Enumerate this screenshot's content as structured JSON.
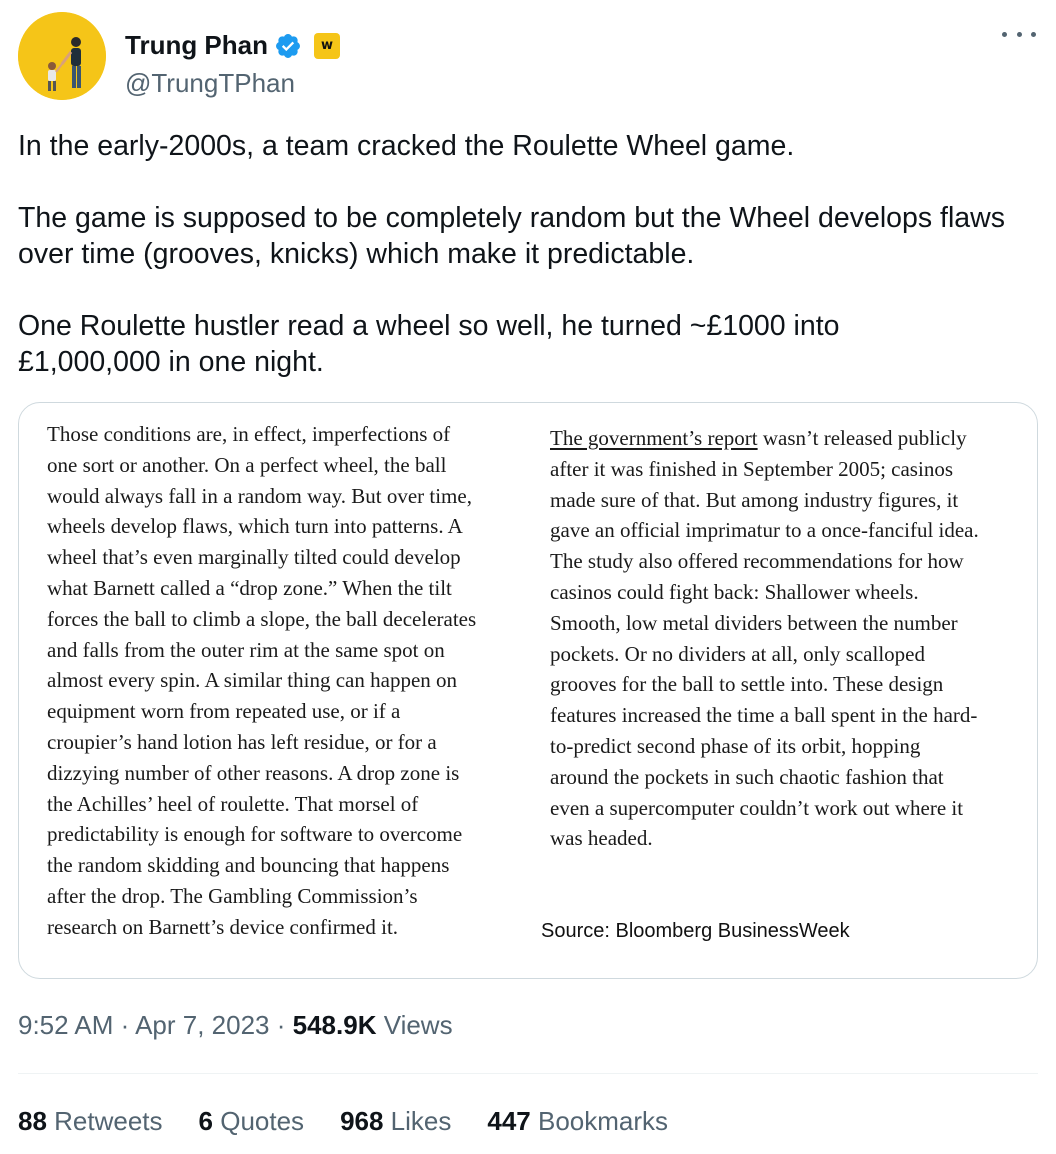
{
  "author": {
    "display_name": "Trung Phan",
    "handle": "@TrungTPhan",
    "affiliate_badge_text": "w"
  },
  "icons": {
    "verified": "verified-badge-icon",
    "affiliate": "affiliate-badge-icon",
    "more": "more-options-icon"
  },
  "colors": {
    "verified_blue": "#1d9bf0",
    "avatar_bg": "#f5c518",
    "secondary_text": "#536471"
  },
  "tweet": {
    "para1": "In the early-2000s, a team cracked the Roulette Wheel game.",
    "para2": "The game is supposed to be completely random but the Wheel develops flaws over time (grooves, knicks) which make it predictable.",
    "para3": "One Roulette hustler read a wheel so well, he turned ~£1000 into £1,000,000 in one night."
  },
  "media": {
    "left_lines": [
      "Those conditions are, in effect, imperfections of",
      "one sort or another. On a perfect wheel, the ball",
      "would always fall in a random way. But over time,",
      "wheels develop flaws, which turn into patterns. A",
      "wheel that’s even marginally tilted could develop",
      "what Barnett called a “drop zone.” When the tilt",
      "forces the ball to climb a slope, the ball decelerates",
      "and falls from the outer rim at the same spot on",
      "almost every spin. A similar thing can happen on",
      "equipment worn from repeated use, or if a",
      "croupier’s hand lotion has left residue, or for a",
      "dizzying number of other reasons. A drop zone is",
      "the Achilles’ heel of roulette. That morsel of",
      "predictability is enough for software to overcome",
      "the random skidding and bouncing that happens",
      "after the drop. The Gambling Commission’s",
      "research on Barnett’s device confirmed it."
    ],
    "right_first_underlined": "The government’s report",
    "right_first_rest": " wasn’t released publicly",
    "right_lines": [
      "after it was finished in September 2005; casinos",
      "made sure of that. But among industry figures, it",
      "gave an official imprimatur to a once-fanciful idea.",
      "The study also offered recommendations for how",
      "casinos could fight back: Shallower wheels.",
      "Smooth, low metal dividers between the number",
      "pockets. Or no dividers at all, only scalloped",
      "grooves for the ball to settle into. These design",
      "features increased the time a ball spent in the hard-",
      "to-predict second phase of its orbit, hopping",
      "around the pockets in such chaotic fashion that",
      "even a supercomputer couldn’t work out where it",
      "was headed."
    ],
    "source": "Source: Bloomberg BusinessWeek"
  },
  "meta": {
    "time": "9:52 AM",
    "sep1": " · ",
    "date": "Apr 7, 2023",
    "sep2": " · ",
    "views_count": "548.9K",
    "views_label": " Views"
  },
  "stats": [
    {
      "count": "88",
      "label": " Retweets"
    },
    {
      "count": "6",
      "label": " Quotes"
    },
    {
      "count": "968",
      "label": " Likes"
    },
    {
      "count": "447",
      "label": " Bookmarks"
    }
  ]
}
